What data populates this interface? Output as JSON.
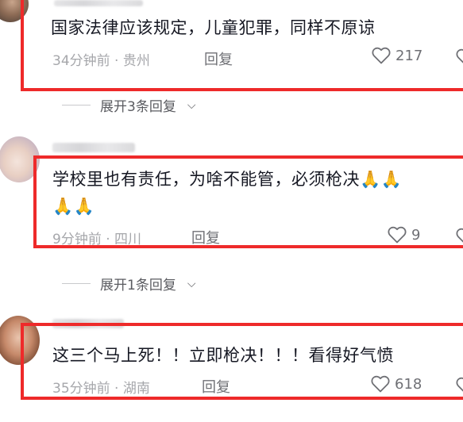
{
  "comments": [
    {
      "text": "国家法律应该规定，儿童犯罪，同样不原谅",
      "meta": "34分钟前 · 贵州",
      "reply_label": "回复",
      "likes": "217",
      "expand_label": "展开3条回复"
    },
    {
      "text_line1": "学校里也有责任，为啥不能管，必须枪决🙏🙏",
      "text_line2": "🙏🙏",
      "meta": "9分钟前 · 四川",
      "reply_label": "回复",
      "likes": "9",
      "expand_label": "展开1条回复"
    },
    {
      "text": "这三个马上死！！立即枪决！！！看得好气愤",
      "meta": "35分钟前 · 湖南",
      "reply_label": "回复",
      "likes": "618"
    }
  ],
  "icons": {
    "like": "heart-outline-icon",
    "expand": "chevron-down-icon"
  },
  "colors": {
    "highlight": "#ee2a2a",
    "meta": "#a6a7ab",
    "text": "#161823"
  }
}
